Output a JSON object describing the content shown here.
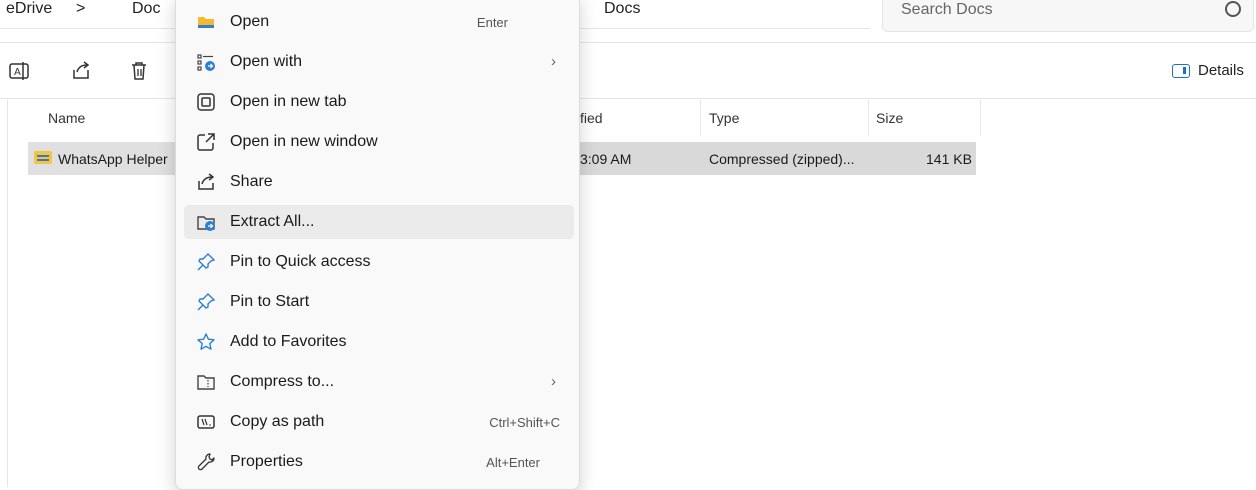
{
  "address": {
    "crumbs": [
      "eDrive",
      ">",
      "Doc",
      "Docs"
    ],
    "search_placeholder": "Search Docs"
  },
  "toolbar": {
    "details_label": "Details"
  },
  "columns": {
    "name": "Name",
    "modified": "fied",
    "type": "Type",
    "size": "Size"
  },
  "file": {
    "name": "WhatsApp Helper",
    "modified": "3:09 AM",
    "type": "Compressed (zipped)...",
    "size": "141 KB"
  },
  "menu": {
    "items": [
      {
        "label": "Open",
        "shortcut": "Enter",
        "icon": "folder-icon"
      },
      {
        "label": "Open with",
        "submenu": "›",
        "icon": "open-with-icon"
      },
      {
        "label": "Open in new tab",
        "icon": "new-tab-icon"
      },
      {
        "label": "Open in new window",
        "icon": "new-window-icon"
      },
      {
        "label": "Share",
        "icon": "share-icon"
      },
      {
        "label": "Extract All...",
        "icon": "extract-icon"
      },
      {
        "label": "Pin to Quick access",
        "icon": "pin-icon"
      },
      {
        "label": "Pin to Start",
        "icon": "pin-icon"
      },
      {
        "label": "Add to Favorites",
        "icon": "star-icon"
      },
      {
        "label": "Compress to...",
        "submenu": "›",
        "icon": "compress-icon"
      },
      {
        "label": "Copy as path",
        "shortcut": "Ctrl+Shift+C",
        "icon": "copy-path-icon"
      },
      {
        "label": "Properties",
        "shortcut": "Alt+Enter",
        "icon": "properties-icon"
      }
    ]
  }
}
